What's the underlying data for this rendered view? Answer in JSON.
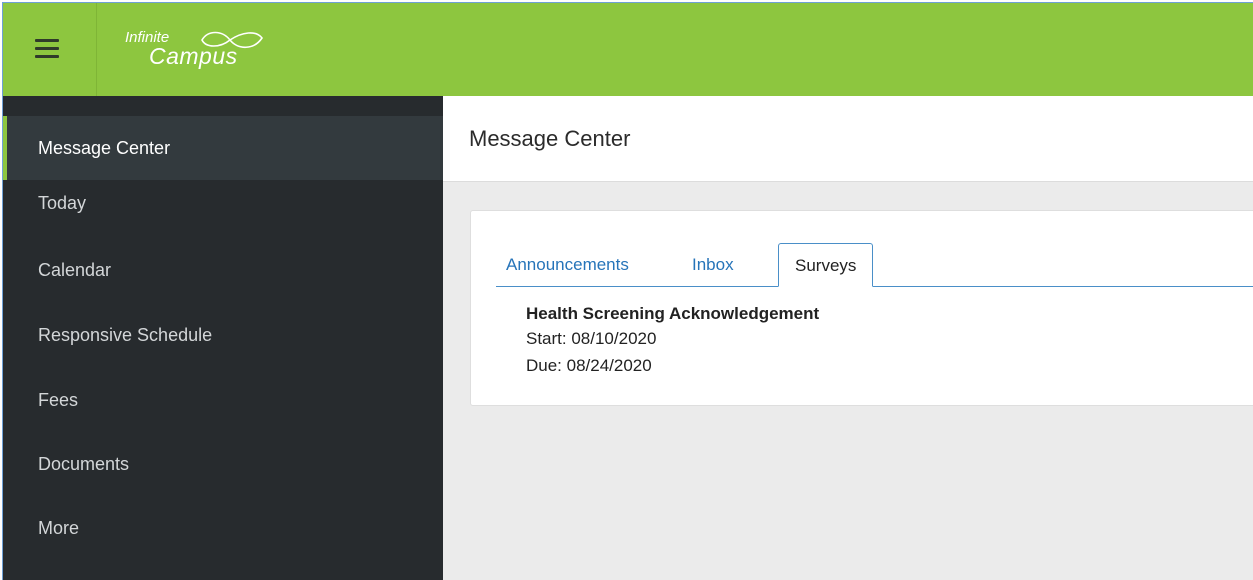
{
  "app": {
    "logo_top": "Infinite",
    "logo_bottom": "Campus"
  },
  "sidebar": {
    "items": [
      {
        "label": "Message Center",
        "active": true
      },
      {
        "label": "Today"
      },
      {
        "label": "Calendar"
      },
      {
        "label": "Responsive Schedule"
      },
      {
        "label": "Fees"
      },
      {
        "label": "Documents"
      },
      {
        "label": "More"
      }
    ]
  },
  "main": {
    "title": "Message Center",
    "tabs": [
      {
        "label": "Announcements"
      },
      {
        "label": "Inbox"
      },
      {
        "label": "Surveys",
        "selected": true
      }
    ],
    "survey": {
      "title": "Health Screening Acknowledgement",
      "start": "Start: 08/10/2020",
      "due": "Due: 08/24/2020"
    }
  },
  "colors": {
    "topbar": "#8dc63f",
    "sidebar": "#272b2e",
    "link": "#2674b9"
  },
  "icons": {
    "menu": "hamburger-icon",
    "logo": "infinity-logo"
  }
}
